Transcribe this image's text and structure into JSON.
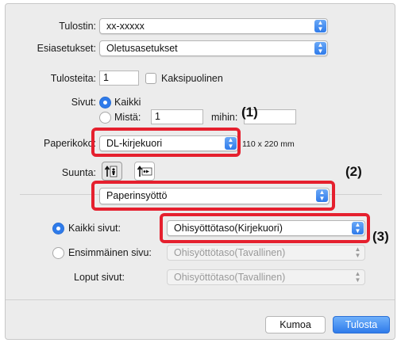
{
  "printer": {
    "label": "Tulostin:",
    "value": "xx-xxxxx"
  },
  "presets": {
    "label": "Esiasetukset:",
    "value": "Oletusasetukset"
  },
  "copies": {
    "label": "Tulosteita:",
    "value": "1",
    "duplex_label": "Kaksipuolinen"
  },
  "pages": {
    "label": "Sivut:",
    "all_label": "Kaikki",
    "from_label": "Mistä:",
    "from_value": "1",
    "to_label": "mihin:",
    "to_value": ""
  },
  "paper": {
    "label": "Paperikoko:",
    "value": "DL-kirjekuori",
    "size": "110 x 220 mm"
  },
  "orientation": {
    "label": "Suunta:",
    "selected": "portrait"
  },
  "panel": {
    "value": "Paperinsyöttö"
  },
  "feed": {
    "all_pages_label": "Kaikki sivut:",
    "all_pages_value": "Ohisyöttötaso(Kirjekuori)",
    "first_page_label": "Ensimmäinen sivu:",
    "first_page_value": "Ohisyöttötaso(Tavallinen)",
    "remaining_label": "Loput sivut:",
    "remaining_value": "Ohisyöttötaso(Tavallinen)"
  },
  "buttons": {
    "cancel": "Kumoa",
    "print": "Tulosta"
  },
  "callouts": {
    "c1": "(1)",
    "c2": "(2)",
    "c3": "(3)"
  },
  "colors": {
    "accent": "#2f7bea",
    "highlight": "#e5202e"
  },
  "icons": {
    "popup": "up-down-chevron-icon",
    "portrait": "portrait-orientation-icon",
    "landscape": "landscape-orientation-icon"
  }
}
